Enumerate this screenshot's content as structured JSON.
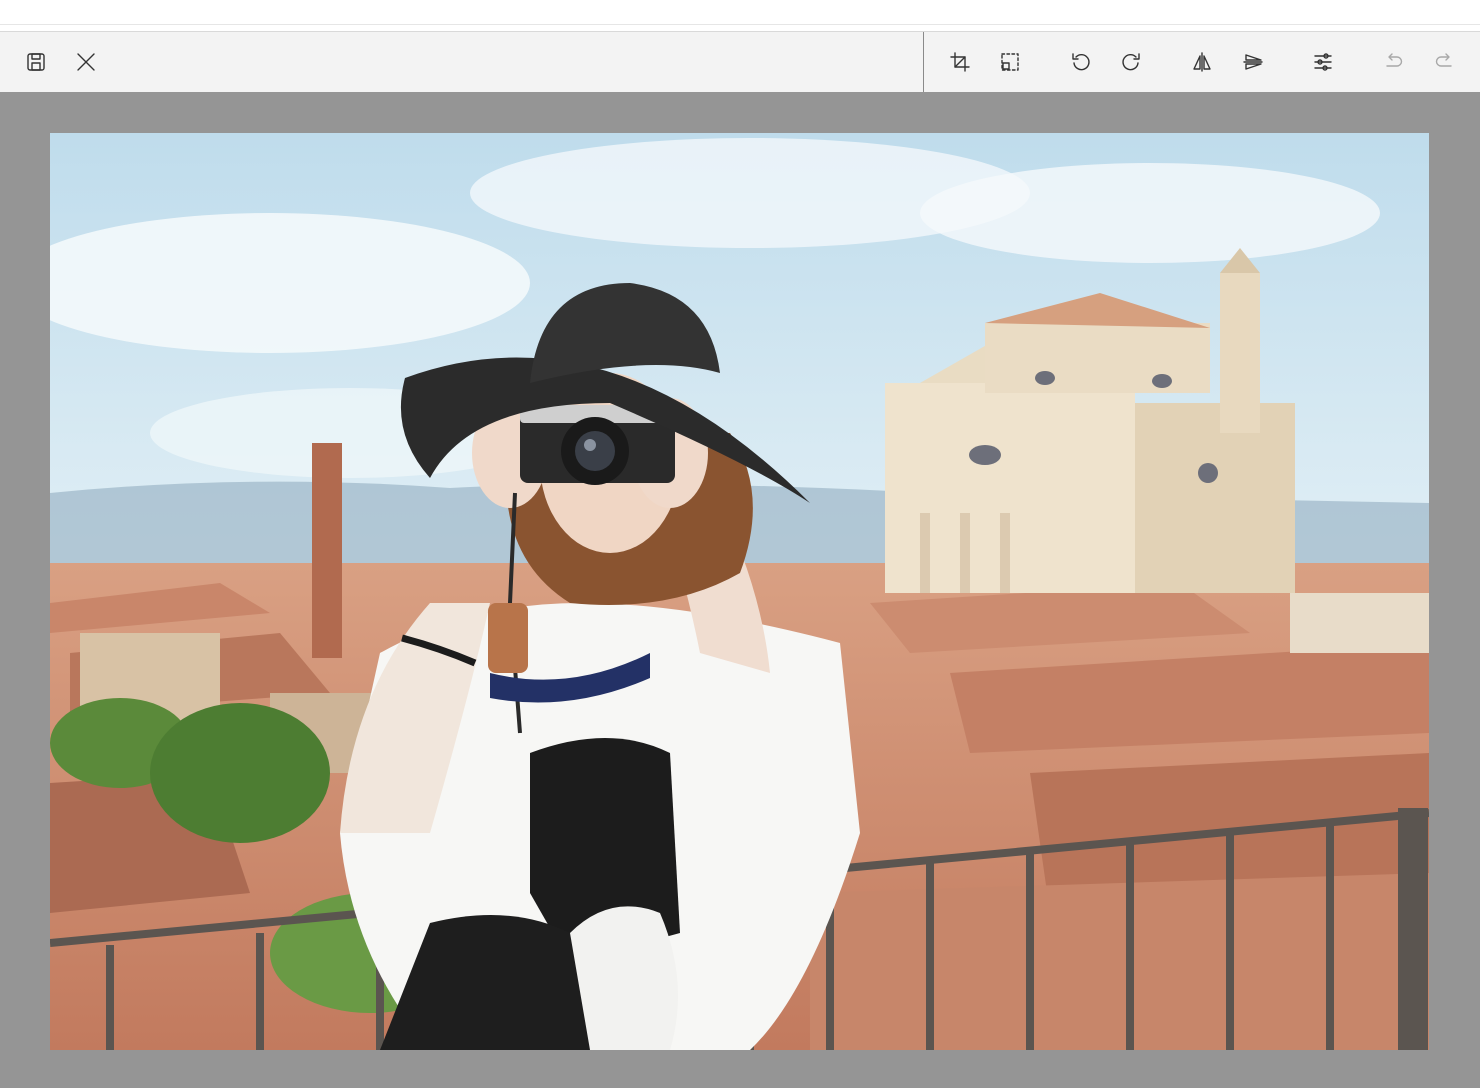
{
  "toolbar": {
    "left_tools": [
      {
        "id": "save",
        "icon": "save-icon"
      },
      {
        "id": "close",
        "icon": "close-icon"
      }
    ],
    "right_tools": [
      {
        "id": "crop",
        "icon": "crop-icon"
      },
      {
        "id": "select-region",
        "icon": "marquee-select-icon"
      },
      {
        "id": "rotate-left",
        "icon": "rotate-left-icon"
      },
      {
        "id": "rotate-right",
        "icon": "rotate-right-icon"
      },
      {
        "id": "flip-horizontal",
        "icon": "flip-horizontal-icon"
      },
      {
        "id": "flip-vertical",
        "icon": "flip-vertical-icon"
      },
      {
        "id": "adjust",
        "icon": "sliders-icon"
      },
      {
        "id": "undo",
        "icon": "undo-icon",
        "disabled": true
      },
      {
        "id": "redo",
        "icon": "redo-icon",
        "disabled": true
      }
    ]
  },
  "canvas": {
    "background": "#959595",
    "image": {
      "subject": "photographer-woman-hat-camera-over-rooftops"
    }
  },
  "colors": {
    "toolbar_bg": "#f3f3f3",
    "icon": "#333333",
    "icon_disabled": "#a8a8a8",
    "sky": "#cfe6f2",
    "roof": "#d3957a",
    "church": "#efe0c8"
  }
}
